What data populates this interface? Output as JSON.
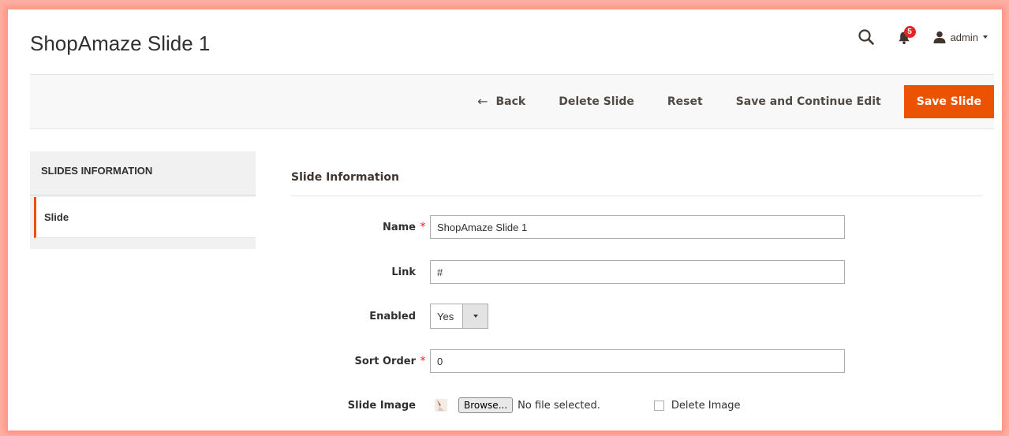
{
  "page": {
    "title": "ShopAmaze Slide 1"
  },
  "header": {
    "notifications_count": "5",
    "user_name": "admin",
    "icons": {
      "search": "search-icon",
      "bell": "bell-icon",
      "user": "user-icon"
    }
  },
  "actions": {
    "back": "Back",
    "delete": "Delete Slide",
    "reset": "Reset",
    "save_continue": "Save and Continue Edit",
    "save": "Save Slide"
  },
  "sidebar": {
    "heading": "SLIDES INFORMATION",
    "items": [
      {
        "label": "Slide"
      }
    ]
  },
  "form": {
    "section_title": "Slide Information",
    "name": {
      "label": "Name",
      "value": "ShopAmaze Slide 1",
      "required": true
    },
    "link": {
      "label": "Link",
      "value": "#"
    },
    "enabled": {
      "label": "Enabled",
      "value": "Yes"
    },
    "sort_order": {
      "label": "Sort Order",
      "value": "0",
      "required": true
    },
    "slide_image": {
      "label": "Slide Image",
      "browse_label": "Browse...",
      "file_status": "No file selected.",
      "delete_label": "Delete Image"
    }
  },
  "colors": {
    "accent": "#eb5202",
    "badge": "#e22626",
    "required": "#e22626"
  }
}
